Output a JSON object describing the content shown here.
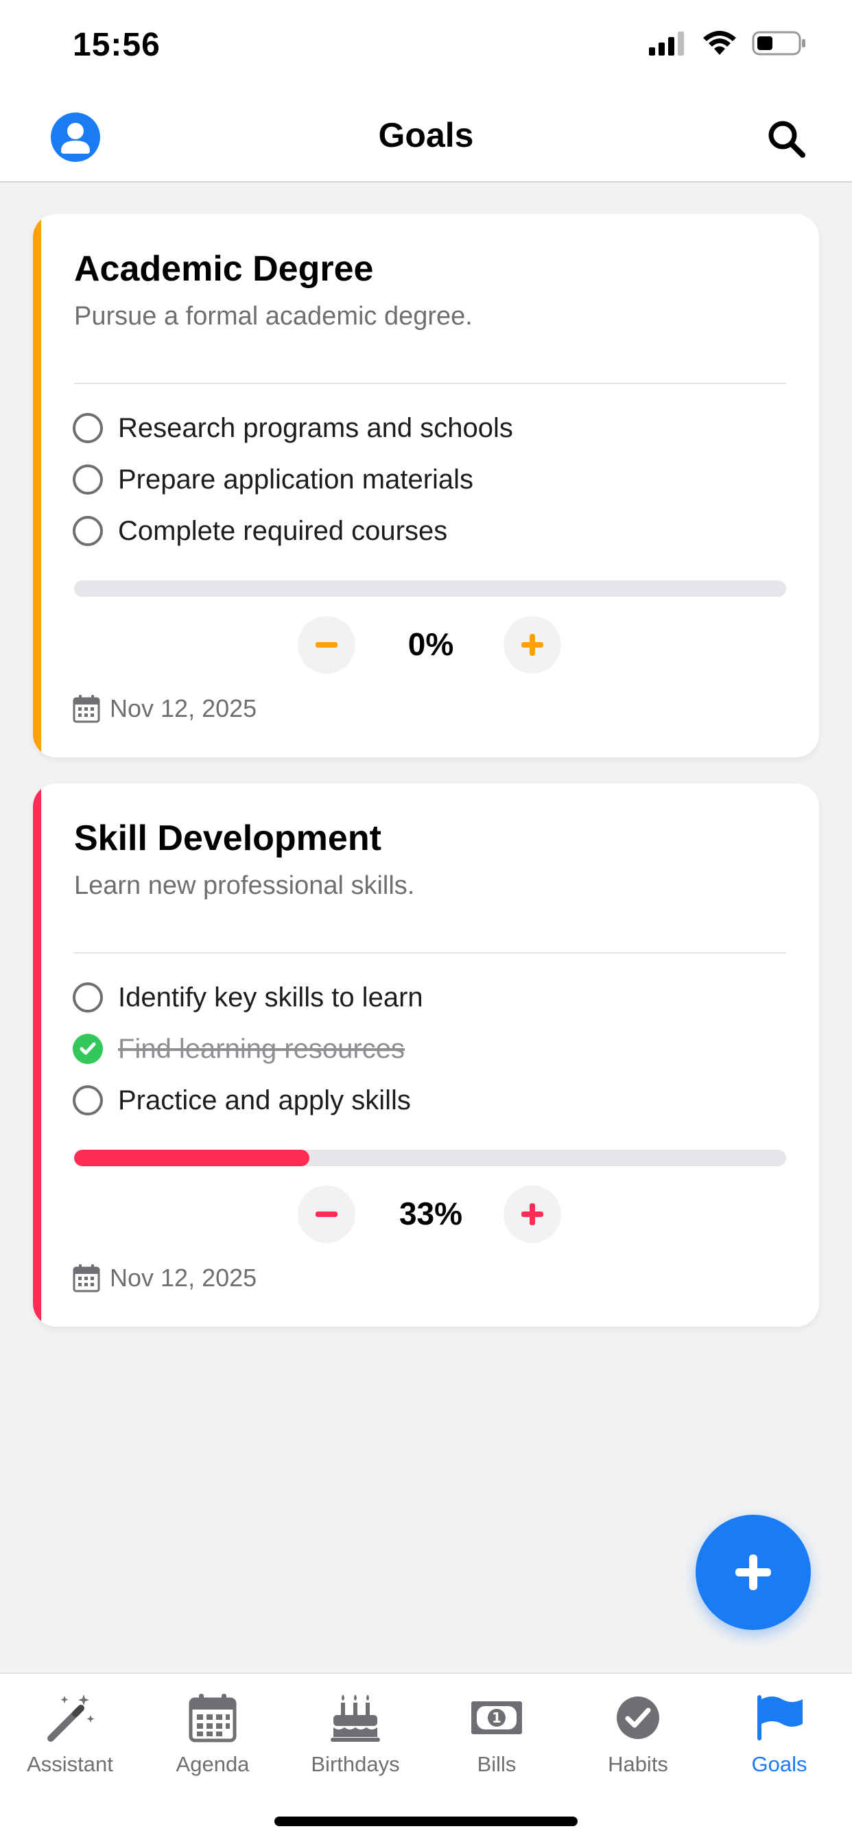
{
  "status_bar": {
    "time": "15:56"
  },
  "header": {
    "title": "Goals",
    "avatar_icon": "user-avatar-icon",
    "search_icon": "search-icon"
  },
  "goals": [
    {
      "title": "Academic Degree",
      "description": "Pursue a formal academic degree.",
      "accent": "#ff9f0a",
      "tasks": [
        {
          "label": "Research programs and schools",
          "done": false
        },
        {
          "label": "Prepare application materials",
          "done": false
        },
        {
          "label": "Complete required courses",
          "done": false
        }
      ],
      "progress": 0,
      "percent_label": "0%",
      "due_date": "Nov 12, 2025"
    },
    {
      "title": "Skill Development",
      "description": "Learn new professional skills.",
      "accent": "#ff2d55",
      "tasks": [
        {
          "label": "Identify key skills to learn",
          "done": false
        },
        {
          "label": "Find learning resources",
          "done": true
        },
        {
          "label": "Practice and apply skills",
          "done": false
        }
      ],
      "progress": 0.33,
      "percent_label": "33%",
      "due_date": "Nov 12, 2025"
    }
  ],
  "fab": {
    "icon": "plus-icon"
  },
  "tabs": [
    {
      "label": "Assistant",
      "icon": "magic-wand-icon",
      "active": false
    },
    {
      "label": "Agenda",
      "icon": "calendar-icon",
      "active": false
    },
    {
      "label": "Birthdays",
      "icon": "birthday-cake-icon",
      "active": false
    },
    {
      "label": "Bills",
      "icon": "banknote-icon",
      "active": false
    },
    {
      "label": "Habits",
      "icon": "check-circle-icon",
      "active": false
    },
    {
      "label": "Goals",
      "icon": "flag-icon",
      "active": true
    }
  ],
  "colors": {
    "accent_blue": "#1a7cf5",
    "done_green": "#34c759"
  }
}
